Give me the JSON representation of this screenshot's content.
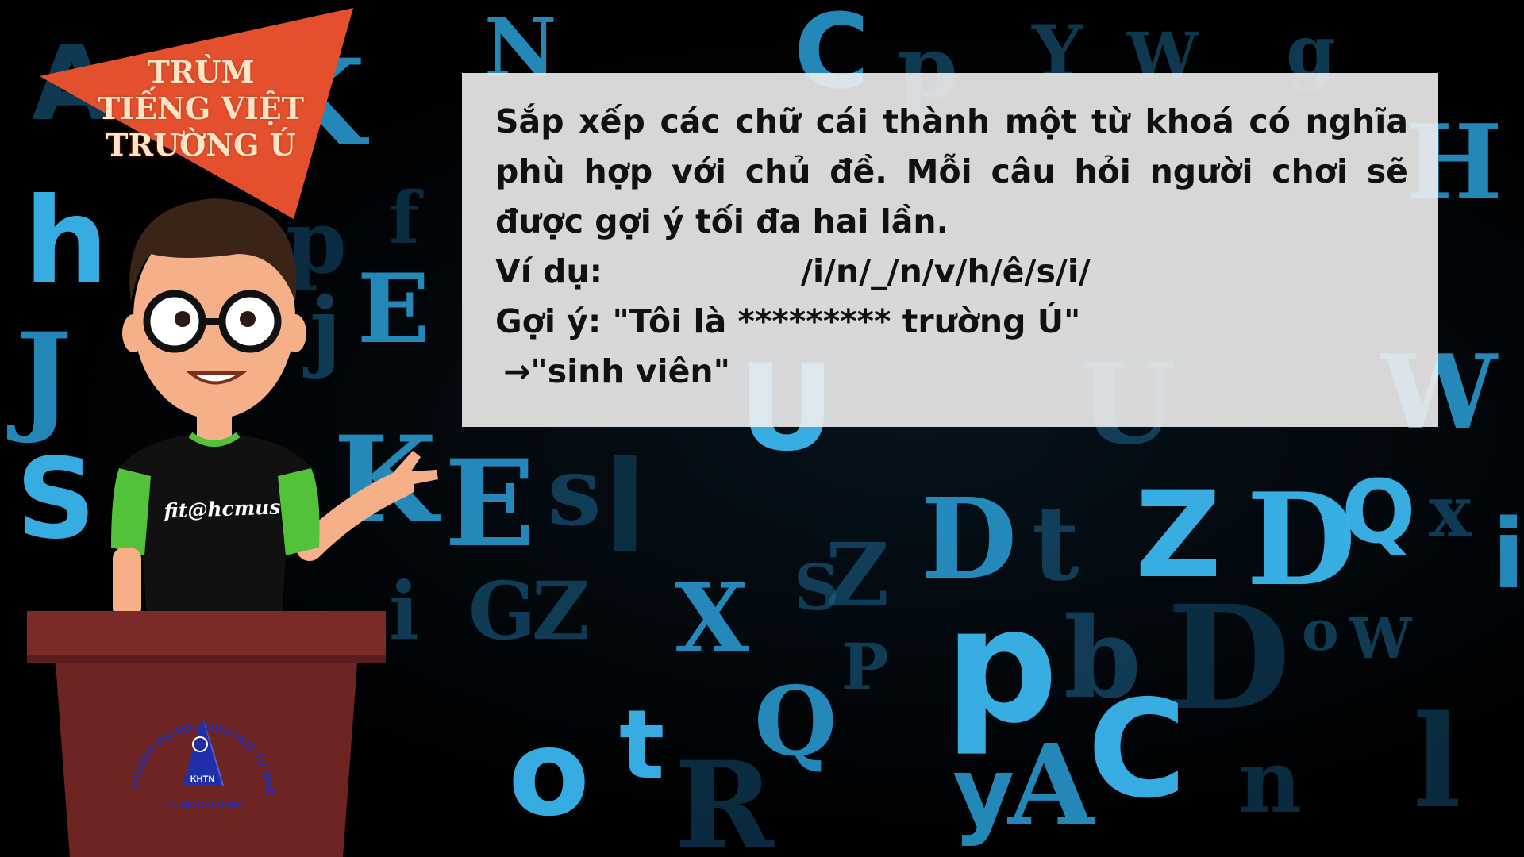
{
  "badge": {
    "lines": [
      "TRÙM",
      "TIẾNG VIỆT",
      "TRƯỜNG Ú"
    ]
  },
  "shirt": {
    "text": "fit@hcmus"
  },
  "podium_logo": {
    "arc_text": "TRƯỜNG ĐẠI HỌC KHOA HỌC TỰ NHIÊN",
    "short": "KHTN",
    "city": "TP. HO CHI MINH"
  },
  "instructions": {
    "rule": "Sắp xếp các chữ cái thành một từ khoá có nghĩa phù hợp với chủ đề. Mỗi câu hỏi người chơi sẽ được gợi ý tối đa hai lần.",
    "example_label": "Ví dụ:",
    "example_value": "/i/n/_/n/v/h/ê/s/i/",
    "hint": "Gợi ý: \"Tôi là ********* trường Ú\"",
    "arrow": "→",
    "answer": "\"sinh viên\""
  },
  "colors": {
    "badge": "#e4502e",
    "panel": "#eeeeee",
    "shirt": "#111111",
    "sleeve": "#53c23a",
    "podium": "#7b2a2a",
    "logo_blue": "#1f2fa8"
  }
}
